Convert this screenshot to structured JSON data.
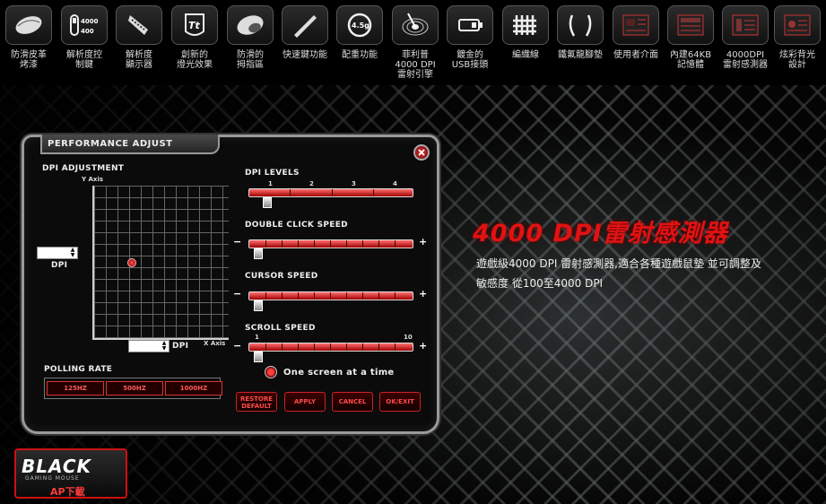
{
  "features": [
    {
      "icon": "mouse-leather-icon",
      "label": "防滑皮革\n烤漆"
    },
    {
      "icon": "dpi-switch-icon",
      "label": "解析度控\n制鍵",
      "icon_text_top": "4000",
      "icon_text_bottom": "400"
    },
    {
      "icon": "dpi-indicator-icon",
      "label": "解析度\n顯示器"
    },
    {
      "icon": "tt-logo-icon",
      "label": "創新的\n燈光效果",
      "icon_text": "Tt"
    },
    {
      "icon": "grip-icon",
      "label": "防滑的\n拇指區"
    },
    {
      "icon": "macro-key-icon",
      "label": "快速鍵功能"
    },
    {
      "icon": "weight-icon",
      "label": "配重功能",
      "icon_text": "4.5g"
    },
    {
      "icon": "laser-engine-icon",
      "label": "菲利普\n4000 DPI\n雷射引擎"
    },
    {
      "icon": "usb-connector-icon",
      "label": "鍍金的\nUSB接頭"
    },
    {
      "icon": "braided-cable-icon",
      "label": "編織線"
    },
    {
      "icon": "teflon-feet-icon",
      "label": "鐵氟龍腳墊"
    },
    {
      "icon": "user-interface-icon",
      "label": "使用者介面"
    },
    {
      "icon": "memory-icon",
      "label": "內建64KB\n記憶體"
    },
    {
      "icon": "sensor-icon",
      "label": "4000DPI\n雷射感測器"
    },
    {
      "icon": "backlight-design-icon",
      "label": "炫彩背光\n設計"
    }
  ],
  "panel": {
    "title": "PERFORMANCE ADJUST",
    "dpi_adjustment": {
      "title": "DPI ADJUSTMENT",
      "y_axis_label": "Y Axis",
      "x_axis_label": "X Axis",
      "y_dpi_label": "DPI",
      "x_dpi_label": "DPI"
    },
    "dpi_levels": {
      "title": "DPI LEVELS",
      "ticks": [
        "1",
        "2",
        "3",
        "4"
      ]
    },
    "double_click": {
      "title": "DOUBLE CLICK SPEED",
      "minus": "−",
      "plus": "+"
    },
    "cursor_speed": {
      "title": "CURSOR SPEED",
      "minus": "−",
      "plus": "+"
    },
    "scroll_speed": {
      "title": "SCROLL SPEED",
      "tick_min": "1",
      "tick_max": "10",
      "minus": "−",
      "plus": "+"
    },
    "one_screen": "One screen at a time",
    "polling_rate": {
      "title": "POLLING RATE",
      "options": [
        "125HZ",
        "500HZ",
        "1000HZ"
      ]
    },
    "buttons": {
      "default": "RESTORE\nDEFAULT",
      "apply": "APPLY",
      "cancel": "CANCEL",
      "ok_exit": "OK/EXIT"
    }
  },
  "promo": {
    "title": "4000 DPI雷射感測器",
    "description": "遊戲級4000 DPI 雷射感測器,適合各種遊戲鼠墊 並可調整及\n敏感度 從100至4000 DPI"
  },
  "logo": {
    "brand": "BLACK",
    "sub": "GAMING MOUSE",
    "download": "AP下載"
  },
  "colors": {
    "accent_red": "#e21212",
    "panel_border": "#9a9a9a"
  }
}
